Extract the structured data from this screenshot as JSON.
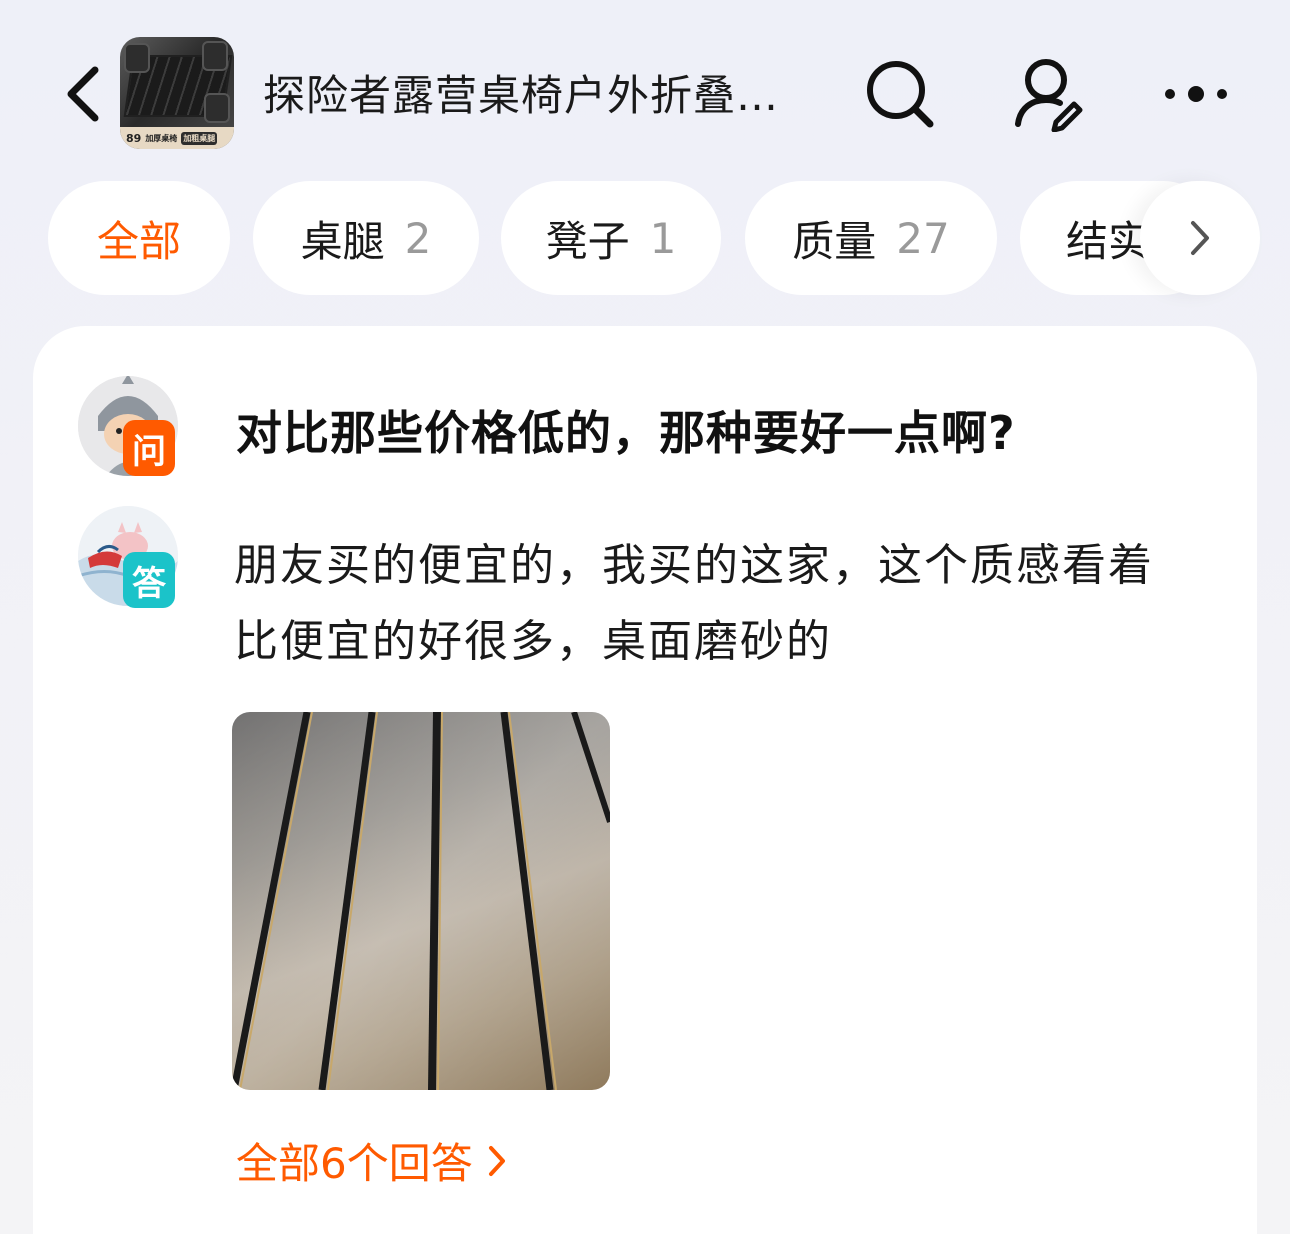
{
  "header": {
    "title": "探险者露营桌椅户外折叠…",
    "thumbnail": {
      "price": "89",
      "tag1": "加厚桌椅",
      "tag2": "加粗桌腿"
    }
  },
  "tabs": [
    {
      "label": "全部",
      "count": ""
    },
    {
      "label": "桌腿",
      "count": "2"
    },
    {
      "label": "凳子",
      "count": "1"
    },
    {
      "label": "质量",
      "count": "27"
    },
    {
      "label": "结实",
      "count": ""
    }
  ],
  "qa": {
    "question_badge": "问",
    "answer_badge": "答",
    "question": "对比那些价格低的，那种要好一点啊?",
    "answer": "朋友买的便宜的，我买的这家，这个质感看着比便宜的好很多，桌面磨砂的",
    "all_answers_label": "全部6个回答"
  },
  "colors": {
    "accent": "#ff5a00",
    "answer_badge": "#1bc3c9",
    "text": "#1a1a1a",
    "muted": "#9a9a9a"
  },
  "icons": {
    "back": "chevron-left-icon",
    "search": "search-icon",
    "user": "user-edit-icon",
    "more": "more-dots-icon",
    "tab_more": "chevron-right-icon"
  }
}
